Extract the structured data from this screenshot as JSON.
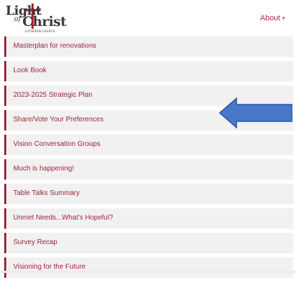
{
  "logo": {
    "line1": "Light",
    "line2": "of",
    "line3": "Christ",
    "line4": "LUTHERAN CHURCH"
  },
  "nav": {
    "about_label": "About",
    "about_caret": "▾"
  },
  "menu": {
    "items": [
      {
        "label": "Masterplan for renovations"
      },
      {
        "label": "Look Book"
      },
      {
        "label": "2023-2025 Strategic Plan"
      },
      {
        "label": "Share/Vote Your Preferences"
      },
      {
        "label": "Vision Conversation Groups"
      },
      {
        "label": "Much is happening!"
      },
      {
        "label": "Table Talks Summary"
      },
      {
        "label": "Unmet Needs...What's Hopeful?"
      },
      {
        "label": "Survey Recap"
      },
      {
        "label": "Visioning for the Future"
      }
    ]
  },
  "annotation": {
    "arrow_color": "#4a78c8",
    "arrow_icon": "left-arrow-icon"
  },
  "colors": {
    "accent": "#a02539",
    "item_background": "#f1f1f1"
  }
}
